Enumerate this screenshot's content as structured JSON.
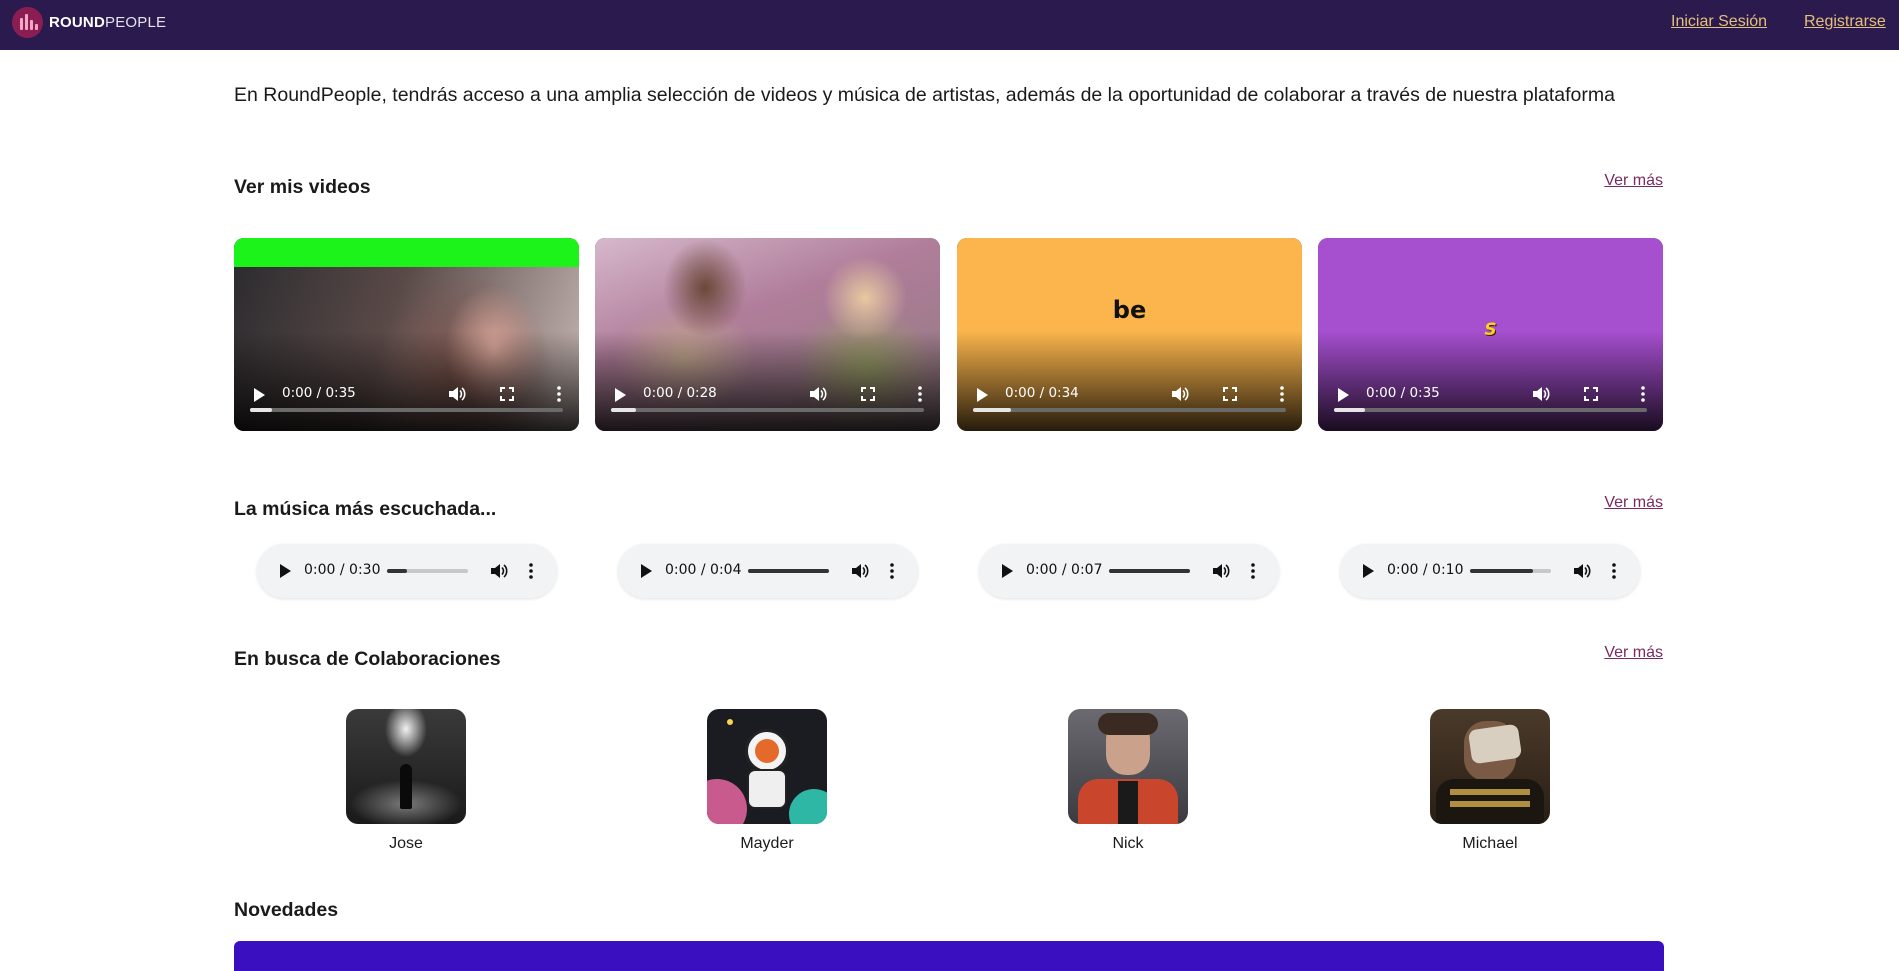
{
  "header": {
    "brand_bold": "ROUND",
    "brand_light": "PEOPLE",
    "login": "Iniciar Sesión",
    "register": "Registrarse"
  },
  "intro": "En RoundPeople, tendrás acceso a una amplia selección de videos y música de artistas, además de la oportunidad de colaborar a través de nuestra plataforma",
  "videos": {
    "title": "Ver mis videos",
    "more": "Ver más",
    "items": [
      {
        "time": "0:00 / 0:35",
        "progress": 0.07
      },
      {
        "time": "0:00 / 0:28",
        "progress": 0.08
      },
      {
        "time": "0:00 / 0:34",
        "progress": 0.12,
        "overlay_text": "be"
      },
      {
        "time": "0:00 / 0:35",
        "progress": 0.1,
        "overlay_text": "S"
      }
    ]
  },
  "music": {
    "title": "La música más escuchada...",
    "more": "Ver más",
    "items": [
      {
        "time": "0:00 / 0:30",
        "progress": 0.25
      },
      {
        "time": "0:00 / 0:04",
        "progress": 1.0
      },
      {
        "time": "0:00 / 0:07",
        "progress": 1.0
      },
      {
        "time": "0:00 / 0:10",
        "progress": 0.78
      }
    ]
  },
  "collabs": {
    "title": "En busca de Colaboraciones",
    "more": "Ver más",
    "items": [
      {
        "name": "Jose"
      },
      {
        "name": "Mayder"
      },
      {
        "name": "Nick"
      },
      {
        "name": "Michael"
      }
    ]
  },
  "news": {
    "title": "Novedades"
  },
  "colors": {
    "header_bg": "#2a1a4e",
    "header_link": "#e4c07a",
    "more_link": "#7a2a62",
    "news_banner": "#3a0fc0"
  }
}
